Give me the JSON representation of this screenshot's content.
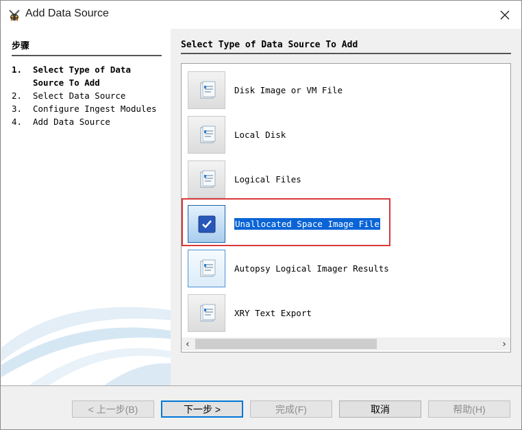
{
  "window": {
    "title": "Add Data Source"
  },
  "steps": {
    "header": "步骤",
    "items": [
      {
        "num": "1.",
        "label": "Select Type of Data Source To Add"
      },
      {
        "num": "2.",
        "label": "Select Data Source"
      },
      {
        "num": "3.",
        "label": "Configure Ingest Modules"
      },
      {
        "num": "4.",
        "label": "Add Data Source"
      }
    ]
  },
  "main": {
    "header": "Select Type of Data Source To Add",
    "sources": [
      {
        "label": "Disk Image or VM File",
        "icon": "document-stack-icon"
      },
      {
        "label": "Local Disk",
        "icon": "document-stack-icon"
      },
      {
        "label": "Logical Files",
        "icon": "document-stack-icon"
      },
      {
        "label": "Unallocated Space Image File",
        "icon": "checkmark-icon"
      },
      {
        "label": "Autopsy Logical Imager Results",
        "icon": "document-stack-icon"
      },
      {
        "label": "XRY Text Export",
        "icon": "document-stack-icon"
      }
    ],
    "selected_index": 3
  },
  "buttons": {
    "back": "< 上一步(B)",
    "next": "下一步 >",
    "finish": "完成(F)",
    "cancel": "取消",
    "help": "帮助(H)"
  },
  "colors": {
    "selection": "#0a64d6",
    "highlight_box": "#d93838",
    "default_button_border": "#0078d7"
  }
}
